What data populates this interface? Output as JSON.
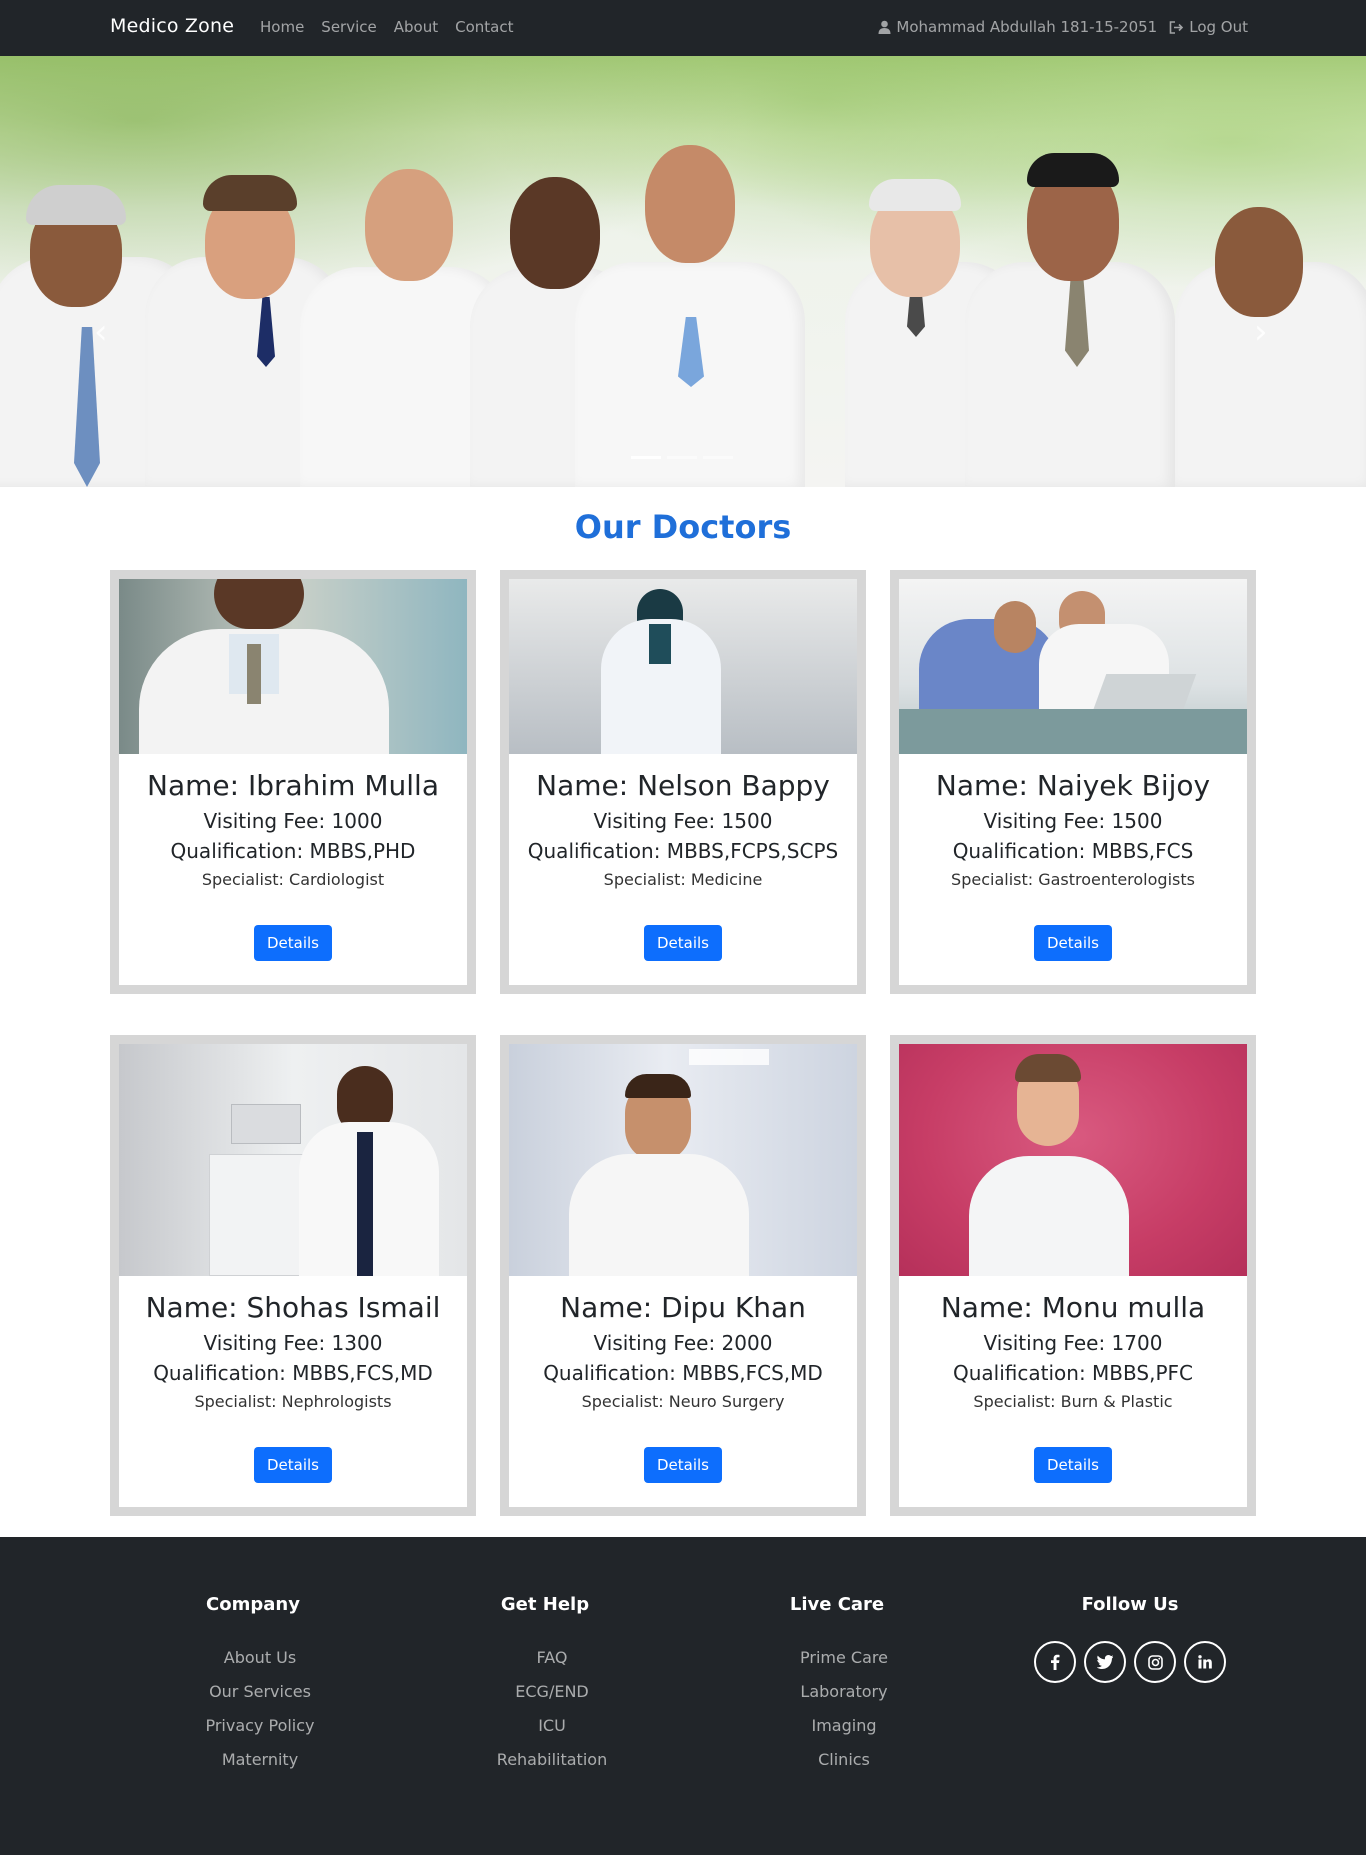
{
  "navbar": {
    "brand": "Medico Zone",
    "links": [
      "Home",
      "Service",
      "About",
      "Contact"
    ],
    "user": "Mohammad Abdullah 181-15-2051",
    "logout": "Log Out"
  },
  "hero": {
    "prev_icon": "chevron-left-icon",
    "next_icon": "chevron-right-icon",
    "slide_count": 3,
    "active_slide": 1
  },
  "section": {
    "title": "Our Doctors"
  },
  "doctors": [
    {
      "name": "Name: Ibrahim Mulla",
      "fee": "Visiting Fee: 1000",
      "qualification": "Qualification: MBBS,PHD",
      "specialist": "Specialist: Cardiologist",
      "button": "Details"
    },
    {
      "name": "Name: Nelson Bappy",
      "fee": "Visiting Fee: 1500",
      "qualification": "Qualification: MBBS,FCPS,SCPS",
      "specialist": "Specialist: Medicine",
      "button": "Details"
    },
    {
      "name": "Name: Naiyek Bijoy",
      "fee": "Visiting Fee: 1500",
      "qualification": "Qualification: MBBS,FCS",
      "specialist": "Specialist: Gastroenterologists",
      "button": "Details"
    },
    {
      "name": "Name: Shohas Ismail",
      "fee": "Visiting Fee: 1300",
      "qualification": "Qualification: MBBS,FCS,MD",
      "specialist": "Specialist: Nephrologists",
      "button": "Details"
    },
    {
      "name": "Name: Dipu Khan",
      "fee": "Visiting Fee: 2000",
      "qualification": "Qualification: MBBS,FCS,MD",
      "specialist": "Specialist: Neuro Surgery",
      "button": "Details"
    },
    {
      "name": "Name: Monu mulla",
      "fee": "Visiting Fee: 1700",
      "qualification": "Qualification: MBBS,PFC",
      "specialist": "Specialist: Burn & Plastic",
      "button": "Details"
    }
  ],
  "footer": {
    "company": {
      "title": "Company",
      "links": [
        "About Us",
        "Our Services",
        "Privacy Policy",
        "Maternity"
      ]
    },
    "help": {
      "title": "Get Help",
      "links": [
        "FAQ",
        "ECG/END",
        "ICU",
        "Rehabilitation"
      ]
    },
    "care": {
      "title": "Live Care",
      "links": [
        "Prime Care",
        "Laboratory",
        "Imaging",
        "Clinics"
      ]
    },
    "follow": {
      "title": "Follow Us",
      "icons": [
        "facebook-icon",
        "twitter-icon",
        "instagram-icon",
        "linkedin-icon"
      ]
    }
  },
  "colors": {
    "navbar": "#212529",
    "accent": "#1f6fd9",
    "button": "#0d6efd",
    "card_border": "#d6d6d6"
  }
}
